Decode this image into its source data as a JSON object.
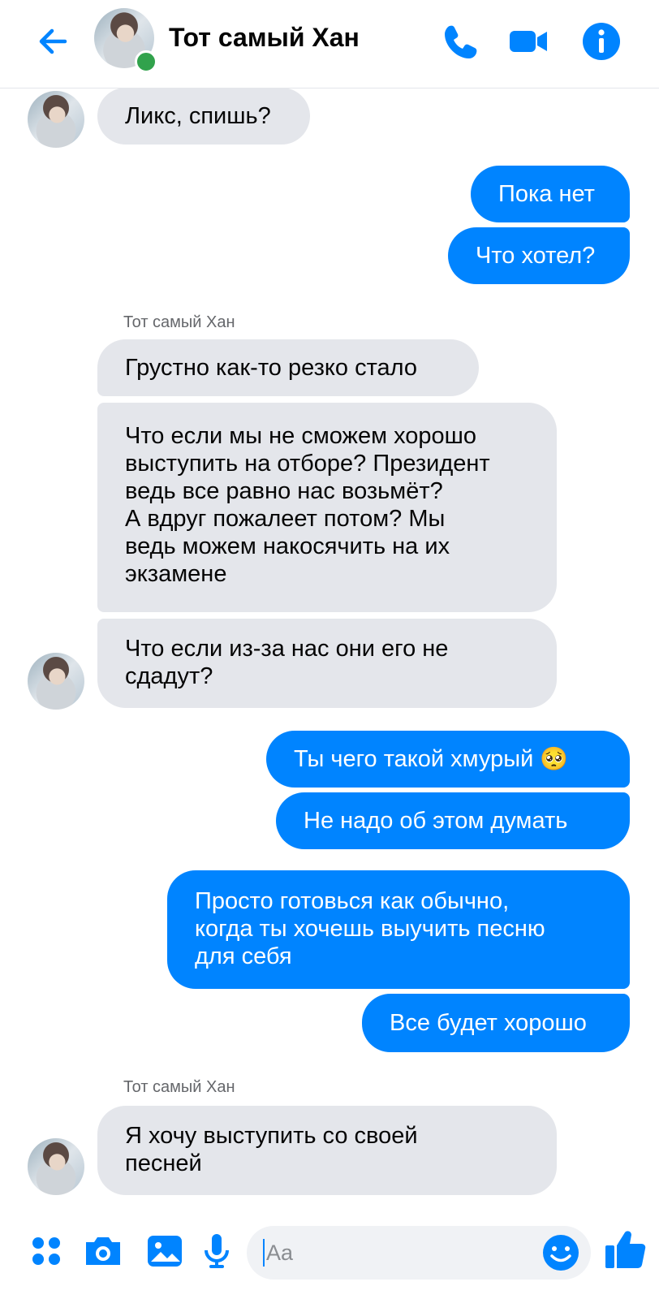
{
  "header": {
    "contact_name": "Тот самый Хан",
    "back_icon": "arrow-left-icon",
    "call_icon": "phone-icon",
    "video_icon": "video-camera-icon",
    "info_icon": "info-icon",
    "accent": "#0084ff",
    "online_color": "#31a24c"
  },
  "messages": {
    "m1": "Ликс, спишь?",
    "m2": "Пока нет",
    "m3": "Что хотел?",
    "sender1": "Тот самый Хан",
    "m4": "Грустно как-то резко стало",
    "m5_l1": "Что если мы не сможем хорошо",
    "m5_l2": "выступить на отборе? Президент",
    "m5_l3": "ведь все равно нас возьмёт?",
    "m5_l4": "А вдруг пожалеет потом? Мы",
    "m5_l5": "ведь можем накосячить на их",
    "m5_l6": "экзамене",
    "m6_l1": "Что если из-за нас они его не",
    "m6_l2": "сдадут?",
    "m7": "Ты чего такой хмурый",
    "m7_emoji": "🥺",
    "m8": "Не надо об этом думать",
    "m9_l1": "Просто готовься как обычно,",
    "m9_l2": "когда ты хочешь выучить песню",
    "m9_l3": "для себя",
    "m10": "Все будет хорошо",
    "sender2": "Тот самый Хан",
    "m11_l1": "Я хочу выступить со своей",
    "m11_l2": "песней"
  },
  "composer": {
    "placeholder": "Aa",
    "icons": [
      "apps-icon",
      "camera-icon",
      "image-icon",
      "microphone-icon",
      "emoji-icon",
      "like-icon"
    ]
  }
}
